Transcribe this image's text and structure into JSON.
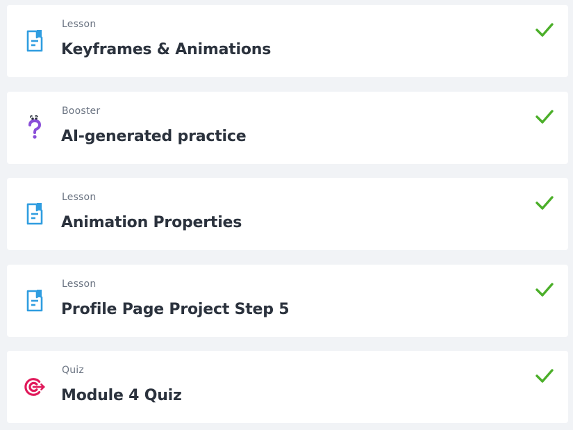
{
  "items": [
    {
      "kind": "Lesson",
      "title": "Keyframes & Animations",
      "icon": "lesson-document-icon",
      "completed": true
    },
    {
      "kind": "Booster",
      "title": "AI-generated practice",
      "icon": "booster-question-icon",
      "completed": true
    },
    {
      "kind": "Lesson",
      "title": "Animation Properties",
      "icon": "lesson-document-icon",
      "completed": true
    },
    {
      "kind": "Lesson",
      "title": "Profile Page Project Step 5",
      "icon": "lesson-document-icon",
      "completed": true
    },
    {
      "kind": "Quiz",
      "title": "Module 4 Quiz",
      "icon": "quiz-target-icon",
      "completed": true
    }
  ],
  "colors": {
    "lesson_icon": "#2f9de0",
    "booster_icon": "#8a4fd8",
    "quiz_icon": "#e0195a",
    "check": "#4caf2a",
    "card_bg": "#ffffff",
    "page_bg": "#f1f3f6"
  }
}
